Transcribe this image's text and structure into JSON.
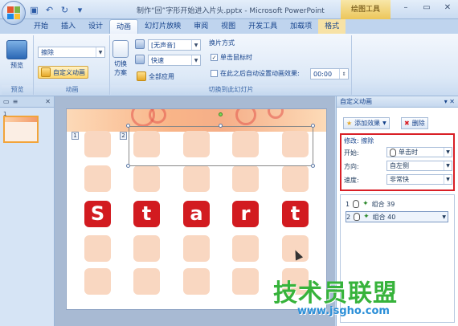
{
  "app": {
    "title": "制作“回”字形开始进入片头.pptx - Microsoft PowerPoint",
    "context_tab_group": "绘图工具"
  },
  "tabs": [
    "开始",
    "插入",
    "设计",
    "动画",
    "幻灯片放映",
    "审阅",
    "视图",
    "开发工具",
    "加载项",
    "格式"
  ],
  "active_tab": "动画",
  "ribbon": {
    "preview": {
      "label": "预览",
      "group": "预览"
    },
    "animation": {
      "effect_combo": "擦除",
      "custom_anim_button": "自定义动画",
      "group": "动画"
    },
    "transition": {
      "switch_scheme": "切换",
      "switch_scheme2": "方案",
      "sound_combo": "[无声音]",
      "speed_combo": "快速",
      "apply_all": "全部应用",
      "advance_title": "换片方式",
      "on_click": "单击鼠标时",
      "auto_after": "在此之后自动设置动画效果:",
      "auto_time": "00:00",
      "group": "切换到此幻灯片"
    }
  },
  "thumbnails": {
    "slide_number": "1"
  },
  "slide": {
    "letters": [
      "S",
      "t",
      "a",
      "r",
      "t"
    ],
    "tags": [
      "1",
      "2"
    ]
  },
  "custom_anim_pane": {
    "title": "自定义动画",
    "add_effect": "添加效果",
    "remove": "删除",
    "modify_label": "修改: 擦除",
    "start_label": "开始:",
    "start_value": "单击时",
    "direction_label": "方向:",
    "direction_value": "自左侧",
    "speed_label": "速度:",
    "speed_value": "非常快",
    "items": [
      {
        "index": "1",
        "name": "组合 39"
      },
      {
        "index": "2",
        "name": "组合 40"
      }
    ]
  },
  "watermark": {
    "text": "技术员联盟",
    "url": "www.jsgho.com"
  },
  "colors": {
    "accent_red": "#d21b20",
    "tile_peach": "#f9d7c1",
    "highlight_border": "#d91f26"
  }
}
